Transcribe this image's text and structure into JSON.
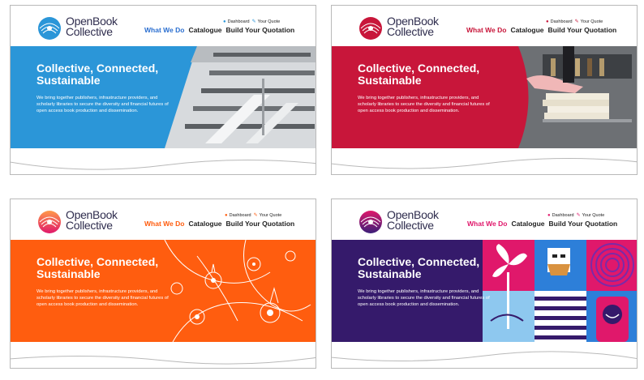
{
  "logo": {
    "line1": "OpenBook",
    "line2": "Collective"
  },
  "utility": {
    "dashboard": "Dashboard",
    "quote": "Your Quote"
  },
  "nav": {
    "what_we_do": "What We Do",
    "catalogue": "Catalogue",
    "build_quote": "Build Your Quotation"
  },
  "hero": {
    "title": "Collective, Connected, Sustainable",
    "body": "We bring together publishers, infrastructure providers, and scholarly libraries to secure the diversity and financial futures of open access book production and dissemination."
  },
  "variants": [
    {
      "name": "blue",
      "accent": "#2b96d8",
      "logo_color": "#2b96d8",
      "nav_active": "#2b6fd0"
    },
    {
      "name": "red",
      "accent": "#c8163a",
      "logo_color": "#c8163a",
      "nav_active": "#c8163a"
    },
    {
      "name": "orange",
      "accent": "#ff5d0f",
      "logo_color": "#ff8a1f",
      "nav_active": "#ff5d0f"
    },
    {
      "name": "purple",
      "accent": "#351a6b",
      "logo_color": "#3a1f79",
      "nav_active": "#e0186b"
    }
  ]
}
